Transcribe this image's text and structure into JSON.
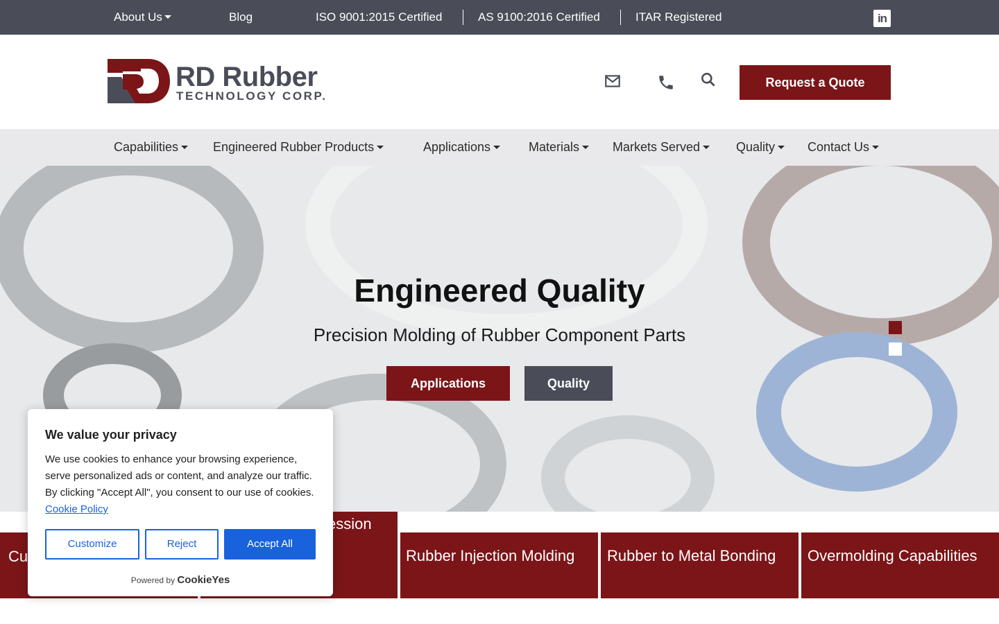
{
  "topbar": {
    "about": "About Us",
    "blog": "Blog",
    "iso": "ISO 9001:2015 Certified",
    "as": "AS 9100:2016 Certified",
    "itar": "ITAR Registered",
    "linkedin_icon": "linkedin-icon"
  },
  "header": {
    "logo_main": "RD Rubber",
    "logo_sub": "TECHNOLOGY CORP.",
    "quote_label": "Request a Quote",
    "icons": [
      "mail-icon",
      "phone-icon",
      "search-icon"
    ]
  },
  "nav": {
    "items": [
      {
        "label": "Capabilities"
      },
      {
        "label": "Engineered Rubber Products"
      },
      {
        "label": "Applications"
      },
      {
        "label": "Materials"
      },
      {
        "label": "Markets Served"
      },
      {
        "label": "Quality"
      },
      {
        "label": "Contact Us"
      }
    ]
  },
  "hero": {
    "title": "Engineered Quality",
    "subtitle": "Precision Molding of Rubber Component Parts",
    "btn_applications": "Applications",
    "btn_quality": "Quality",
    "slides_total": 2,
    "active_slide": 1
  },
  "tiles": [
    {
      "label": "Cu"
    },
    {
      "label": "ession"
    },
    {
      "label": "Rubber Injection Molding"
    },
    {
      "label": "Rubber to Metal Bonding"
    },
    {
      "label": "Overmolding Capabilities"
    }
  ],
  "cookie": {
    "title": "We value your privacy",
    "body": "We use cookies to enhance your browsing experience, serve personalized ads or content, and analyze our traffic. By clicking \"Accept All\", you consent to our use of cookies.",
    "policy_link": "Cookie Policy",
    "customize": "Customize",
    "reject": "Reject",
    "accept": "Accept All",
    "powered_by": "Powered by",
    "brand": "CookieYes"
  },
  "colors": {
    "brand_red": "#7b1518",
    "topbar_gray": "#4a4d58",
    "nav_bg": "#e9e9eb",
    "cookie_blue": "#1863dc"
  }
}
